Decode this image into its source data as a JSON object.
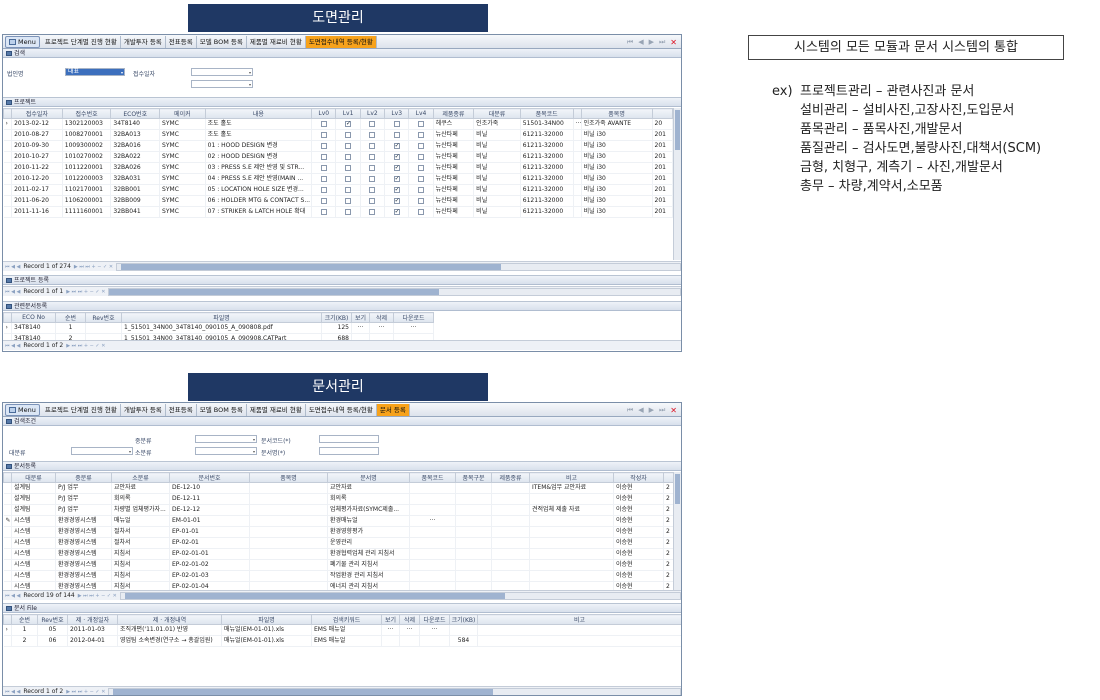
{
  "banners": {
    "drawing": "도면관리",
    "document": "문서관리"
  },
  "side": {
    "box_title": "시스템의 모든 모듈과 문서 시스템의 통합",
    "prefix": "ex)",
    "lines": [
      "프로젝트관리 – 관련사진과 문서",
      "설비관리 – 설비사진,고장사진,도입문서",
      "품목관리 – 품목사진,개발문서",
      "품질관리 – 검사도면,불량사진,대책서(SCM)",
      "금형, 치형구, 계측기 – 사진,개발문서",
      "총무 – 차량,계약서,소모품"
    ]
  },
  "top": {
    "tabs": [
      "Menu",
      "프로젝트 단계별 진행 현황",
      "개발투자 등록",
      "전표등록",
      "모델 BOM 등록",
      "제품별 재료비 현황",
      "도면접수내역 등록/현황"
    ],
    "active_tab": 6,
    "search_title": "검색",
    "corp_label": "법인명",
    "corp_value": "대표",
    "date_label": "접수일자",
    "project_title": "프로젝트",
    "columns": [
      "접수일자",
      "접수번호",
      "ECO번호",
      "메이커",
      "내용",
      "Lv0",
      "Lv1",
      "Lv2",
      "Lv3",
      "Lv4",
      "제품종류",
      "대분류",
      "품목코드",
      "",
      "품목명",
      ""
    ],
    "rows": [
      {
        "d": "2013-02-12",
        "n": "1302120003",
        "eco": "34T8140",
        "mk": "SYMC",
        "desc": "조도 홀도",
        "lv": [
          0,
          1,
          0,
          0,
          0
        ],
        "kind": "헤쿠스",
        "big": "인조가죽",
        "code": "51501-34N00",
        "dots": "···",
        "name": "인조가죽 AVANTE",
        "y": "20"
      },
      {
        "d": "2010-08-27",
        "n": "1008270001",
        "eco": "32BA013",
        "mk": "SYMC",
        "desc": "조도 홀도",
        "lv": [
          0,
          0,
          0,
          0,
          0
        ],
        "kind": "뉴산타페",
        "big": "비닐",
        "code": "61211-32000",
        "dots": "",
        "name": "비닐 i30",
        "y": "201"
      },
      {
        "d": "2010-09-30",
        "n": "1009300002",
        "eco": "32BA016",
        "mk": "SYMC",
        "desc": "01 : HOOD DESIGN 변경",
        "lv": [
          0,
          0,
          0,
          1,
          0
        ],
        "kind": "뉴산타페",
        "big": "비닐",
        "code": "61211-32000",
        "dots": "",
        "name": "비닐 i30",
        "y": "201"
      },
      {
        "d": "2010-10-27",
        "n": "1010270002",
        "eco": "32BA022",
        "mk": "SYMC",
        "desc": "02 : HOOD DESIGN 변경",
        "lv": [
          0,
          0,
          0,
          1,
          0
        ],
        "kind": "뉴산타페",
        "big": "비닐",
        "code": "61211-32000",
        "dots": "",
        "name": "비닐 i30",
        "y": "201"
      },
      {
        "d": "2010-11-22",
        "n": "1011220001",
        "eco": "32BA026",
        "mk": "SYMC",
        "desc": "03 : PRESS S.E 제안 반영 및 STR...",
        "lv": [
          0,
          0,
          0,
          1,
          0
        ],
        "kind": "뉴산타페",
        "big": "비닐",
        "code": "61211-32000",
        "dots": "",
        "name": "비닐 i30",
        "y": "201"
      },
      {
        "d": "2010-12-20",
        "n": "1012200003",
        "eco": "32BA031",
        "mk": "SYMC",
        "desc": "04 : PRESS S.E 제안 반영(MAIN ...",
        "lv": [
          0,
          0,
          0,
          1,
          0
        ],
        "kind": "뉴산타페",
        "big": "비닐",
        "code": "61211-32000",
        "dots": "",
        "name": "비닐 i30",
        "y": "201"
      },
      {
        "d": "2011-02-17",
        "n": "1102170001",
        "eco": "32BB001",
        "mk": "SYMC",
        "desc": "05 : LOCATION HOLE SIZE 변경...",
        "lv": [
          0,
          0,
          0,
          1,
          0
        ],
        "kind": "뉴산타페",
        "big": "비닐",
        "code": "61211-32000",
        "dots": "",
        "name": "비닐 i30",
        "y": "201"
      },
      {
        "d": "2011-06-20",
        "n": "1106200001",
        "eco": "32BB009",
        "mk": "SYMC",
        "desc": "06 : HOLDER MTG & CONTACT S...",
        "lv": [
          0,
          0,
          0,
          1,
          0
        ],
        "kind": "뉴산타페",
        "big": "비닐",
        "code": "61211-32000",
        "dots": "",
        "name": "비닐 i30",
        "y": "201"
      },
      {
        "d": "2011-11-16",
        "n": "1111160001",
        "eco": "32BB041",
        "mk": "SYMC",
        "desc": "07 : STRIKER & LATCH HOLE 확대",
        "lv": [
          0,
          0,
          0,
          1,
          0
        ],
        "kind": "뉴산타페",
        "big": "비닐",
        "code": "61211-32000",
        "dots": "",
        "name": "비닐 i30",
        "y": "201"
      }
    ],
    "record": "Record 1 of 274",
    "reg_title": "프로젝트 등록",
    "reg_record": "Record 1 of 1",
    "files_title": "관련문서등록",
    "file_columns": [
      "ECO No",
      "순번",
      "Rev번호",
      "파일명",
      "크기(KB)",
      "보기",
      "삭제",
      "다운로드"
    ],
    "files": [
      {
        "eco": "34T8140",
        "seq": "1",
        "rev": "",
        "name": "1_51501_34N00_34T8140_090105_A_090808.pdf",
        "size": "125",
        "v": "···",
        "del": "···",
        "dl": "···"
      },
      {
        "eco": "34T8140",
        "seq": "2",
        "rev": "",
        "name": "1_51501_34N00_34T8140_090105_A_090908.CATPart",
        "size": "688",
        "v": "",
        "del": "",
        "dl": ""
      }
    ],
    "files_record": "Record 1 of 2"
  },
  "bottom": {
    "tabs": [
      "Menu",
      "프로젝트 단계별 진행 현황",
      "개발투자 등록",
      "전표등록",
      "모델 BOM 등록",
      "제품별 재료비 현황",
      "도면접수내역 등록/현황",
      "문서 등록"
    ],
    "active_tab": 7,
    "search_title": "검색조건",
    "mid_label": "중분류",
    "big_label": "대분류",
    "small_label": "소분류",
    "doc_code_label": "문서코드(*)",
    "doc_name_label": "문서명(*)",
    "list_title": "문서등록",
    "columns": [
      "대분류",
      "중분류",
      "소분류",
      "문서번호",
      "품목명",
      "문서명",
      "품목코드",
      "품목구분",
      "제품종류",
      "비고",
      "작성자",
      ""
    ],
    "rows": [
      {
        "a": "설계팀",
        "b": "P/J 업무",
        "c": "교안자료",
        "no": "DE-12-10",
        "item": "",
        "name": "교안자료",
        "code": "",
        "gb": "",
        "kind": "",
        "note": "ITEM&업무 교안자료",
        "w": "이승현",
        "z": "2"
      },
      {
        "a": "설계팀",
        "b": "P/J 업무",
        "c": "회의록",
        "no": "DE-12-11",
        "item": "",
        "name": "회의록",
        "code": "",
        "gb": "",
        "kind": "",
        "note": "",
        "w": "이승현",
        "z": "2"
      },
      {
        "a": "설계팀",
        "b": "P/J 업무",
        "c": "차량별 업체평가자...",
        "no": "DE-12-12",
        "item": "",
        "name": "업체평가자료(SYMC제출...",
        "code": "",
        "gb": "",
        "kind": "",
        "note": "견적업체 제출 자료",
        "w": "이승현",
        "z": "2"
      },
      {
        "a": "시스템",
        "b": "환경경영시스템",
        "c": "매뉴얼",
        "no": "EM-01-01",
        "item": "",
        "name": "환경매뉴얼",
        "code": "···",
        "gb": "",
        "kind": "",
        "note": "",
        "w": "이승현",
        "z": "2"
      },
      {
        "a": "시스템",
        "b": "환경경영시스템",
        "c": "절차서",
        "no": "EP-01-01",
        "item": "",
        "name": "환경영향평가",
        "code": "",
        "gb": "",
        "kind": "",
        "note": "",
        "w": "이승현",
        "z": "2"
      },
      {
        "a": "시스템",
        "b": "환경경영시스템",
        "c": "절차서",
        "no": "EP-02-01",
        "item": "",
        "name": "운영관리",
        "code": "",
        "gb": "",
        "kind": "",
        "note": "",
        "w": "이승현",
        "z": "2"
      },
      {
        "a": "시스템",
        "b": "환경경영시스템",
        "c": "지침서",
        "no": "EP-02-01-01",
        "item": "",
        "name": "환경협력업체 관리 지침서",
        "code": "",
        "gb": "",
        "kind": "",
        "note": "",
        "w": "이승현",
        "z": "2"
      },
      {
        "a": "시스템",
        "b": "환경경영시스템",
        "c": "지침서",
        "no": "EP-02-01-02",
        "item": "",
        "name": "폐기물 관리 지침서",
        "code": "",
        "gb": "",
        "kind": "",
        "note": "",
        "w": "이승현",
        "z": "2"
      },
      {
        "a": "시스템",
        "b": "환경경영시스템",
        "c": "지침서",
        "no": "EP-02-01-03",
        "item": "",
        "name": "작업환경 관리 지침서",
        "code": "",
        "gb": "",
        "kind": "",
        "note": "",
        "w": "이승현",
        "z": "2"
      },
      {
        "a": "시스템",
        "b": "환경경영시스템",
        "c": "지침서",
        "no": "EP-02-01-04",
        "item": "",
        "name": "에너지 관리 지침서",
        "code": "",
        "gb": "",
        "kind": "",
        "note": "",
        "w": "이승현",
        "z": "2"
      }
    ],
    "record": "Record 19 of 144",
    "file_title": "문서 File",
    "file_columns": [
      "순번",
      "Rev번호",
      "제 · 개정일자",
      "제 · 개정내역",
      "파일명",
      "검색키워드",
      "보기",
      "삭제",
      "다운로드",
      "크기(KB)",
      "비고"
    ],
    "files": [
      {
        "seq": "1",
        "rev": "05",
        "date": "2011-01-03",
        "hist": "조직개편('11.01.01) 반영",
        "fname": "매뉴얼(EM-01-01).xls",
        "kw": "EMS 매뉴얼",
        "v": "···",
        "del": "···",
        "dl": "···",
        "size": "",
        "note": ""
      },
      {
        "seq": "2",
        "rev": "06",
        "date": "2012-04-01",
        "hist": "영업팀 소속변경(연구소 → 총괄임원)",
        "fname": "매뉴얼(EM-01-01).xls",
        "kw": "EMS 매뉴얼",
        "v": "",
        "del": "",
        "dl": "",
        "size": "584",
        "note": ""
      }
    ],
    "files_record": "Record 1 of 2"
  }
}
